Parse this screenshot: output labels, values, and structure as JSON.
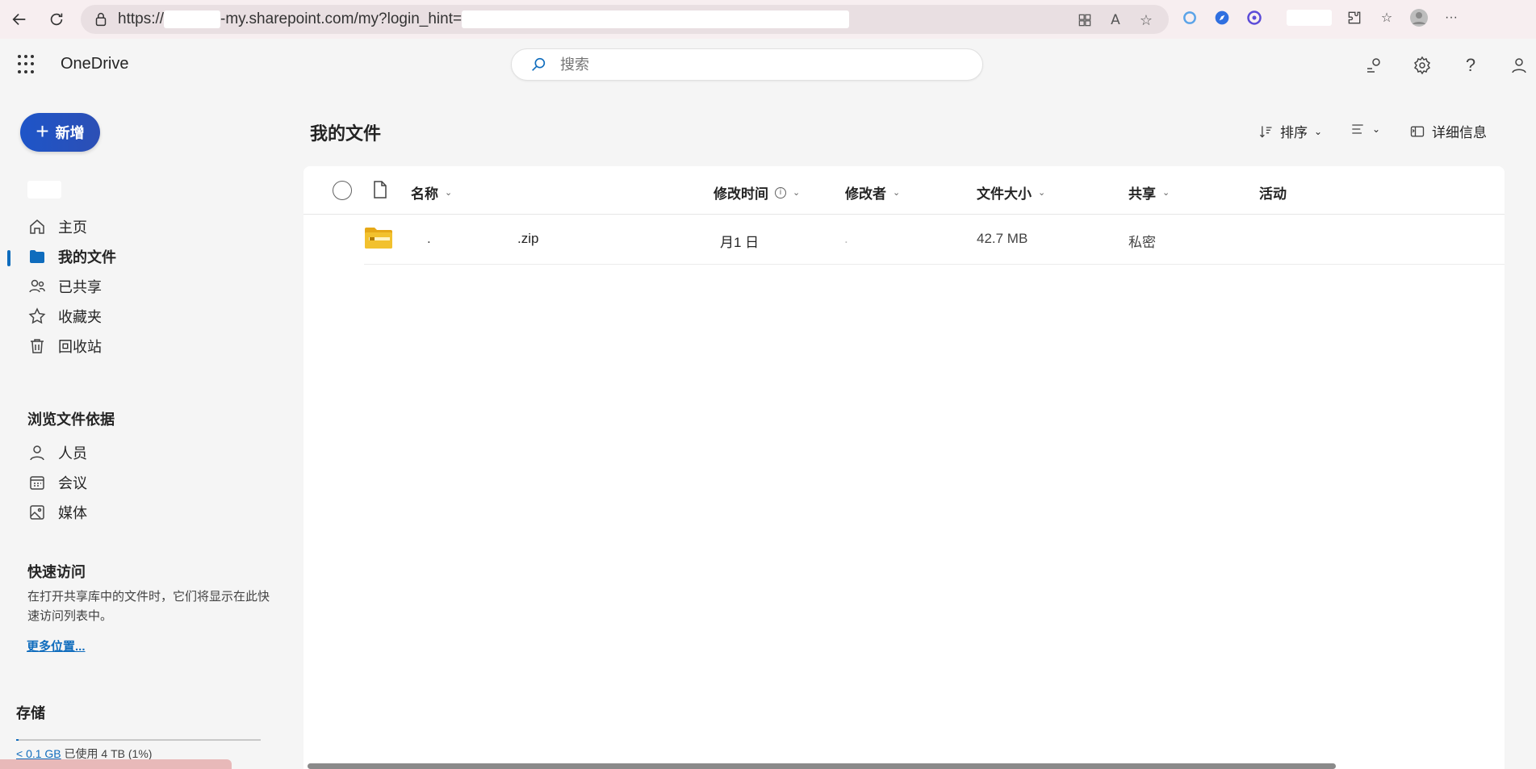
{
  "browser": {
    "url_prefix": "https://",
    "url_middle": "-my.sharepoint.com/my?login_hint=",
    "icons": [
      "back-icon",
      "refresh-icon",
      "lock-icon",
      "apps-icon",
      "read-aloud-icon",
      "favorite-icon",
      "extensions-icon",
      "favorites-bar-icon",
      "profile-icon",
      "more-icon"
    ]
  },
  "header": {
    "app_name": "OneDrive",
    "search_placeholder": "搜索"
  },
  "nav": {
    "new_label": "新增",
    "items": [
      {
        "label": "主页"
      },
      {
        "label": "我的文件"
      },
      {
        "label": "已共享"
      },
      {
        "label": "收藏夹"
      },
      {
        "label": "回收站"
      }
    ],
    "browse_title": "浏览文件依据",
    "browse_items": [
      {
        "label": "人员"
      },
      {
        "label": "会议"
      },
      {
        "label": "媒体"
      }
    ],
    "quick_title": "快速访问",
    "quick_desc": "在打开共享库中的文件时，它们将显示在此快速访问列表中。",
    "more_link": "更多位置...",
    "storage_title": "存储",
    "storage_used": "< 0.1 GB",
    "storage_text": " 已使用 4 TB (1%)",
    "storage_percent": 1
  },
  "main": {
    "title": "我的文件",
    "sort_label": "排序",
    "details_label": "详细信息",
    "columns": {
      "name": "名称",
      "modified": "修改时间",
      "modified_by": "修改者",
      "size": "文件大小",
      "sharing": "共享",
      "activity": "活动"
    },
    "files": [
      {
        "name_left": ".",
        "name_ext": ".zip",
        "modified": "月1  日",
        "modified_by": ".",
        "size": "42.7 MB",
        "sharing": "私密"
      }
    ]
  },
  "colors": {
    "accent": "#0f6cbd",
    "new_button": "#1e55c8",
    "zip_folder": "#f2c12e"
  }
}
